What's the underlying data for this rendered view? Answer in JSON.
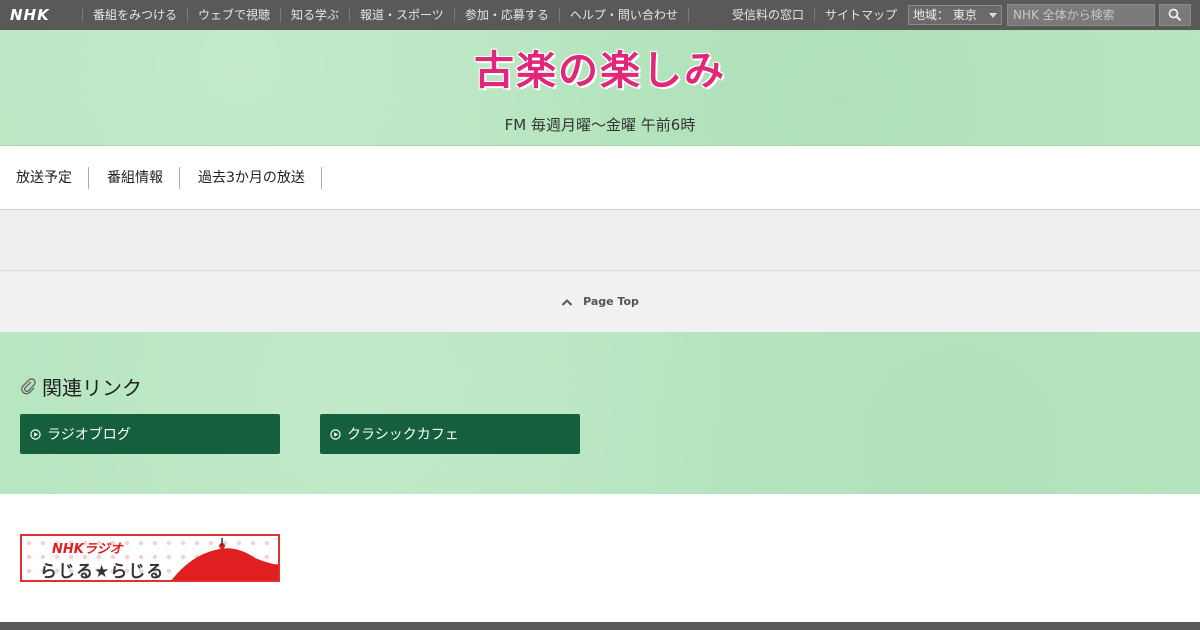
{
  "global_nav": {
    "logo": "NHK",
    "items": [
      "番組をみつける",
      "ウェブで視聴",
      "知る学ぶ",
      "報道・スポーツ",
      "参加・応募する",
      "ヘルプ・問い合わせ"
    ],
    "right_items": [
      "受信料の窓口",
      "サイトマップ"
    ],
    "region_select": "地域： 東京",
    "search_placeholder": "NHK 全体から検索"
  },
  "header": {
    "program_title": "古楽の楽しみ",
    "schedule": "FM 毎週月曜～金曜 午前6時"
  },
  "subnav": {
    "tabs": [
      "放送予定",
      "番組情報",
      "過去3か月の放送"
    ]
  },
  "page_top": {
    "label": "Page Top"
  },
  "related": {
    "heading": "関連リンク",
    "links": [
      "ラジオブログ",
      "クラシックカフェ"
    ]
  },
  "banner": {
    "line1": "NHKラジオ",
    "line2": "らじる★らじる"
  },
  "colors": {
    "topbar": "#595959",
    "header_bg": "#b7e6c0",
    "title_pink": "#e0287a",
    "link_button": "#155f3f",
    "banner_red": "#e03030"
  }
}
